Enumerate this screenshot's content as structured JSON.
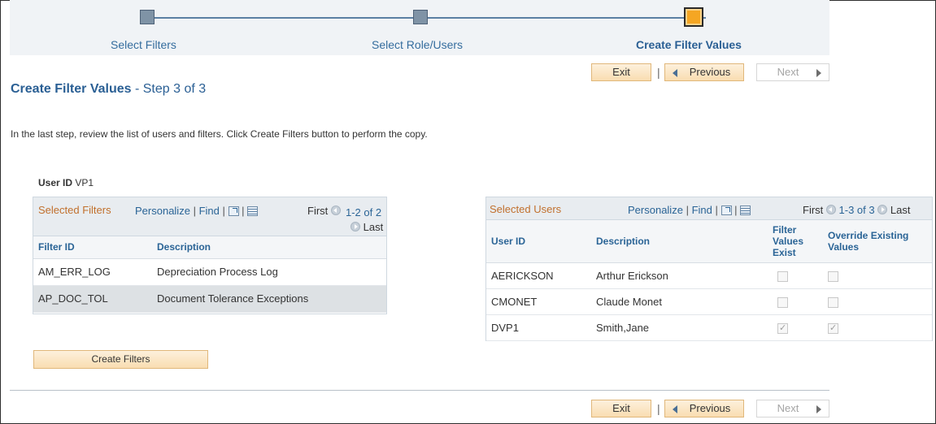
{
  "train": {
    "steps": [
      {
        "label": "Select Filters"
      },
      {
        "label": "Select Role/Users"
      },
      {
        "label": "Create Filter Values"
      }
    ]
  },
  "nav": {
    "exit": "Exit",
    "previous": "Previous",
    "next": "Next",
    "separator": "|"
  },
  "page": {
    "title": "Create Filter Values",
    "step": "- Step 3 of 3",
    "instructions": "In the last step, review the list of users and filters.  Click Create Filters button to perform the copy.",
    "user_id_label": "User ID",
    "user_id_value": "VP1",
    "create_button": "Create Filters"
  },
  "filters_grid": {
    "title": "Selected Filters",
    "personalize": "Personalize",
    "find": "Find",
    "first": "First",
    "range": "1-2 of 2",
    "last": "Last",
    "columns": [
      "Filter ID",
      "Description"
    ],
    "rows": [
      {
        "id": "AM_ERR_LOG",
        "desc": "Depreciation Process Log"
      },
      {
        "id": "AP_DOC_TOL",
        "desc": "Document Tolerance Exceptions"
      }
    ]
  },
  "users_grid": {
    "title": "Selected Users",
    "personalize": "Personalize",
    "find": "Find",
    "first": "First",
    "range": "1-3 of 3",
    "last": "Last",
    "columns": [
      "User ID",
      "Description",
      "Filter Values Exist",
      "Override Existing Values"
    ],
    "rows": [
      {
        "id": "AERICKSON",
        "desc": "Arthur Erickson",
        "exist": false,
        "override": false
      },
      {
        "id": "CMONET",
        "desc": "Claude Monet",
        "exist": false,
        "override": false
      },
      {
        "id": "DVP1",
        "desc": "Smith,Jane",
        "exist": true,
        "override": true
      }
    ]
  }
}
